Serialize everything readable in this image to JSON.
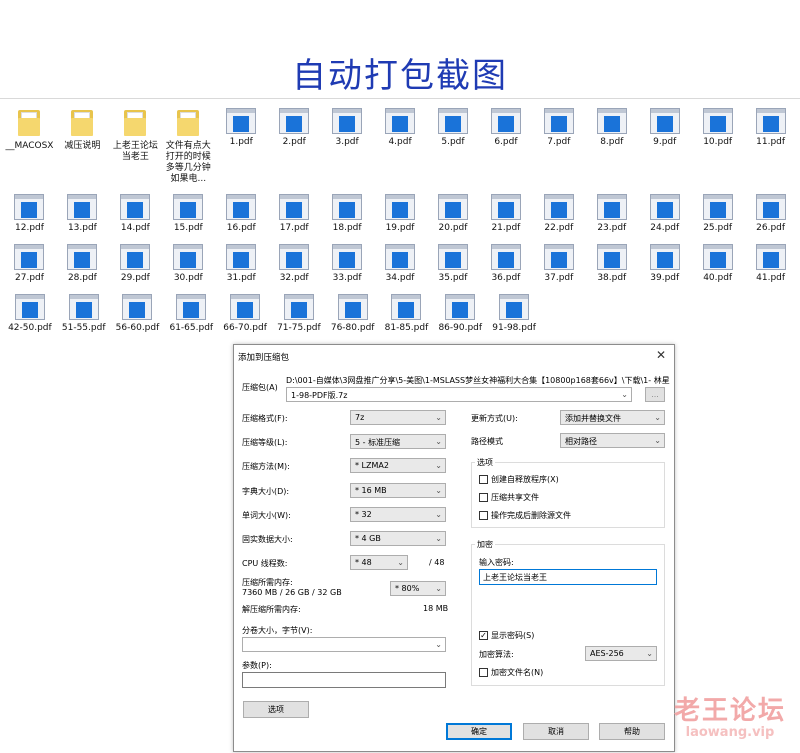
{
  "page": {
    "title": "自动打包截图"
  },
  "files": {
    "folders": [
      {
        "label": "__MACOSX"
      },
      {
        "label": "减压说明"
      },
      {
        "label": "上老王论坛当老王"
      },
      {
        "label": "文件有点大打开的时候多等几分钟如果电..."
      }
    ],
    "row1_pdfs": [
      "1.pdf",
      "2.pdf",
      "3.pdf",
      "4.pdf",
      "5.pdf",
      "6.pdf",
      "7.pdf",
      "8.pdf",
      "9.pdf",
      "10.pdf",
      "11.pdf"
    ],
    "row2_pdfs": [
      "12.pdf",
      "13.pdf",
      "14.pdf",
      "15.pdf",
      "16.pdf",
      "17.pdf",
      "18.pdf",
      "19.pdf",
      "20.pdf",
      "21.pdf",
      "22.pdf",
      "23.pdf",
      "24.pdf",
      "25.pdf",
      "26.pdf"
    ],
    "row3_pdfs": [
      "27.pdf",
      "28.pdf",
      "29.pdf",
      "30.pdf",
      "31.pdf",
      "32.pdf",
      "33.pdf",
      "34.pdf",
      "35.pdf",
      "36.pdf",
      "37.pdf",
      "38.pdf",
      "39.pdf",
      "40.pdf",
      "41.pdf"
    ],
    "row4_pdfs": [
      "42-50.pdf",
      "51-55.pdf",
      "56-60.pdf",
      "61-65.pdf",
      "66-70.pdf",
      "71-75.pdf",
      "76-80.pdf",
      "81-85.pdf",
      "86-90.pdf",
      "91-98.pdf"
    ]
  },
  "dialog": {
    "title": "添加到压缩包",
    "close": "✕",
    "archive_label": "压缩包(A)",
    "archive_path": "D:\\001-自媒体\\3网盘推广分享\\5-美图\\1-MSLASS梦丝女神福利大合集【10800p168套66v】\\下载\\1- 林星",
    "archive_name": "1-98-PDF版.7z",
    "browse": "...",
    "format_label": "压缩格式(F):",
    "format_value": "7z",
    "level_label": "压缩等级(L):",
    "level_value": "5 - 标准压缩",
    "method_label": "压缩方法(M):",
    "method_value": "* LZMA2",
    "dict_label": "字典大小(D):",
    "dict_value": "* 16 MB",
    "word_label": "单词大小(W):",
    "word_value": "* 32",
    "solid_label": "固实数据大小:",
    "solid_value": "* 4 GB",
    "threads_label": "CPU 线程数:",
    "threads_value": "* 48",
    "threads_total": "/ 48",
    "mem_comp_label": "压缩所需内存:",
    "mem_comp_detail": "7360 MB / 26 GB / 32 GB",
    "mem_percent": "* 80%",
    "mem_decomp_label": "解压缩所需内存:",
    "mem_decomp_value": "18 MB",
    "split_label": "分卷大小，字节(V):",
    "split_value": "",
    "params_label": "参数(P):",
    "params_value": "",
    "options_button": "选项",
    "update_label": "更新方式(U):",
    "update_value": "添加并替换文件",
    "pathmode_label": "路径模式",
    "pathmode_value": "相对路径",
    "options_group": "选项",
    "opt_sfx": "创建自释放程序(X)",
    "opt_shared": "压缩共享文件",
    "opt_delete": "操作完成后删除源文件",
    "enc_group": "加密",
    "pwd_label": "输入密码:",
    "pwd_value": "上老王论坛当老王",
    "show_pwd": "显示密码(S)",
    "enc_method_label": "加密算法:",
    "enc_method_value": "AES-256",
    "enc_names": "加密文件名(N)",
    "ok": "确定",
    "cancel": "取消",
    "help": "帮助"
  },
  "watermark": {
    "cn": "老王论坛",
    "en": "laowang.vip"
  }
}
